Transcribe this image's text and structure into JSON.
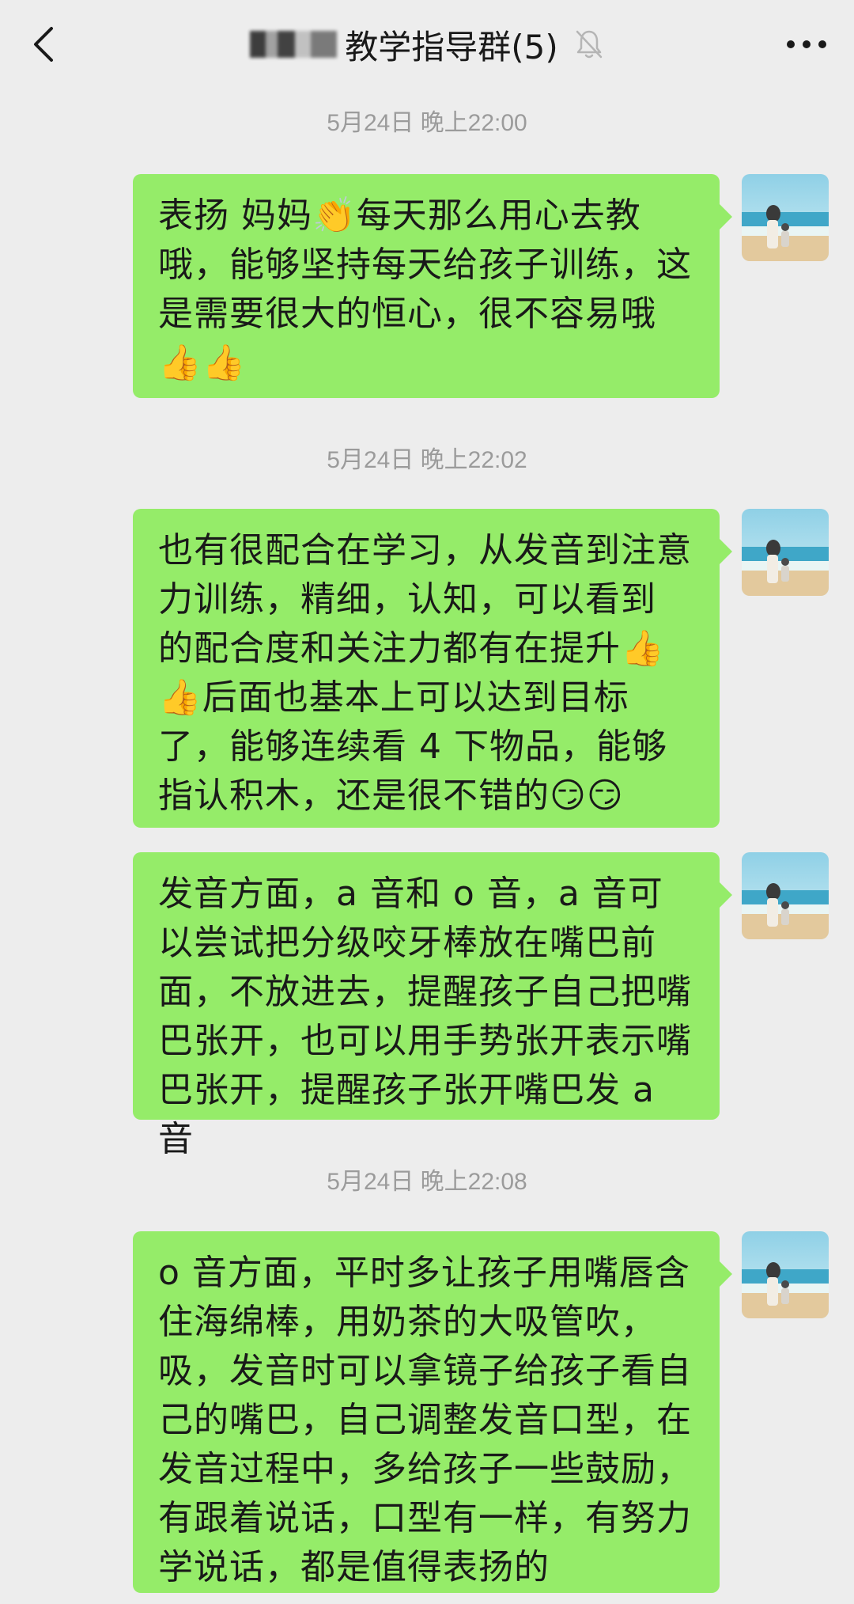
{
  "nav": {
    "back_icon": "chevron-left-icon",
    "title": "教学指导群(5)",
    "mute_icon": "bell-off-icon",
    "more_icon": "more-dots-icon"
  },
  "timestamps": [
    "5月24日 晚上22:00",
    "5月24日 晚上22:02",
    "5月24日 晚上22:08"
  ],
  "messages": [
    {
      "text": "表扬 妈妈👏每天那么用心去教 哦，能够坚持每天给孩子训练，这是需要很大的恒心，很不容易哦👍👍"
    },
    {
      "text": "也有很配合在学习，从发音到注意力训练，精细，认知，可以看到 的配合度和关注力都有在提升👍👍后面也基本上可以达到目标了，能够连续看 4 下物品，能够指认积木，还是很不错的😏😏"
    },
    {
      "text": "发音方面，a 音和 o 音，a 音可以尝试把分级咬牙棒放在嘴巴前面，不放进去，提醒孩子自己把嘴巴张开，也可以用手势张开表示嘴巴张开，提醒孩子张开嘴巴发 a 音"
    },
    {
      "text": "o 音方面，平时多让孩子用嘴唇含住海绵棒，用奶茶的大吸管吹，吸，发音时可以拿镜子给孩子看自己的嘴巴，自己调整发音口型，在发音过程中，多给孩子一些鼓励，有跟着说话，口型有一样，有努力学说话，都是值得表扬的"
    }
  ],
  "colors": {
    "background": "#ededed",
    "bubble": "#95ec69",
    "timestamp": "#9b9b9b",
    "text": "#191919"
  }
}
